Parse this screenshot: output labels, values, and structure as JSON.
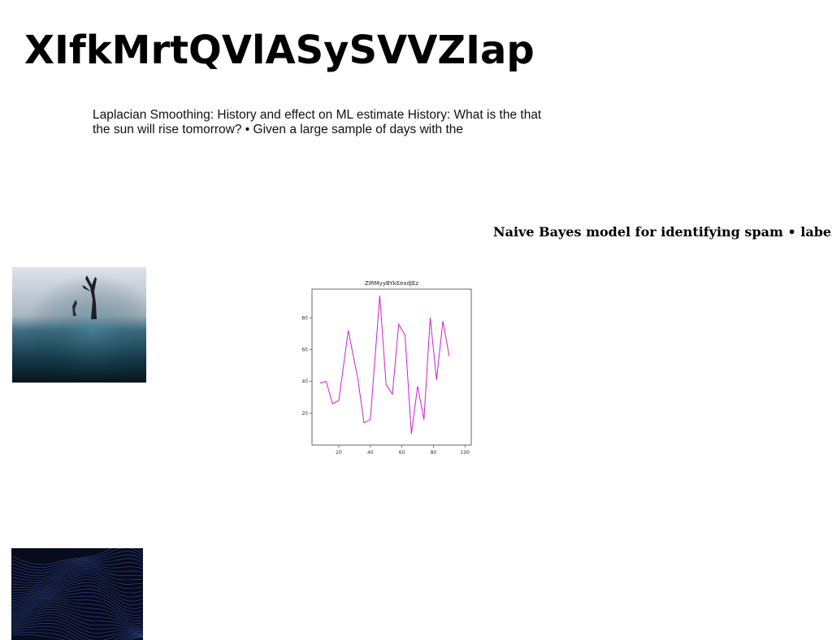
{
  "page": {
    "title": "XIfkMrtQVlASySVVZIap",
    "paragraph": "Laplacian Smoothing: History and effect on ML estimate History: What is the that the sun will rise tomorrow? • Given a large sample of days with the",
    "side_text": "Naive Bayes model for identifying spam • label: binary • y ={ spam, ham } • Features: counts in the document (bag-of-words) • x ="
  },
  "chart_data": {
    "type": "line",
    "title": "ZIRMyyBYkEexdJEz",
    "xlabel": "",
    "ylabel": "",
    "x": [
      8,
      12,
      16,
      20,
      24,
      28,
      32,
      36,
      40,
      44,
      48,
      52,
      56,
      60,
      64,
      68,
      72,
      76,
      80,
      84,
      88,
      92,
      96,
      100
    ],
    "series": [
      {
        "values": [
          39,
          40,
          26,
          28,
          72,
          42,
          14,
          16,
          94,
          38,
          32,
          76,
          69,
          7,
          37,
          16,
          80,
          41,
          78,
          56
        ]
      }
    ],
    "x_plot": [
      8,
      12,
      16,
      20,
      26,
      32,
      36,
      40,
      46,
      50,
      54,
      58,
      62,
      66,
      70,
      74,
      78,
      82,
      86,
      90
    ],
    "xticks": [
      20,
      40,
      60,
      80,
      100
    ],
    "yticks": [
      20,
      40,
      60,
      80
    ],
    "xlim": [
      3,
      104
    ],
    "ylim": [
      0,
      98
    ],
    "grid": false,
    "line_color": "#cc22cc"
  },
  "images": {
    "tree_photo": "misty-field-with-bare-tree-and-figure",
    "waves_image": "dark-blue-wave-mesh"
  }
}
